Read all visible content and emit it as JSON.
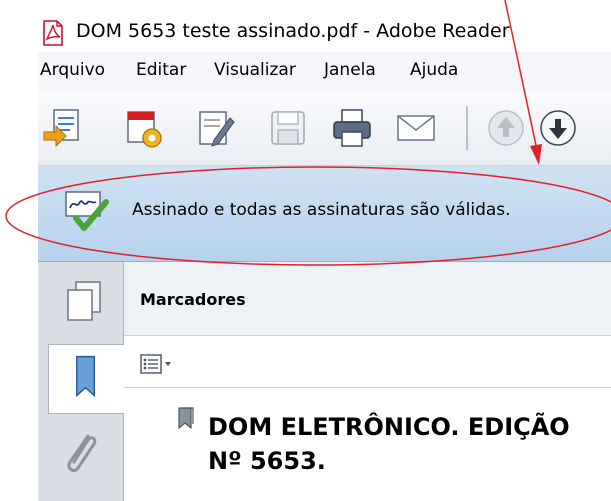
{
  "window": {
    "title": "DOM 5653 teste assinado.pdf - Adobe Reader"
  },
  "menubar": {
    "items": [
      "Arquivo",
      "Editar",
      "Visualizar",
      "Janela",
      "Ajuda"
    ]
  },
  "toolbar": {
    "buttons": [
      "create-pdf-icon",
      "settings-pdf-icon",
      "edit-icon",
      "save-icon",
      "print-icon",
      "email-icon",
      "prev-page-icon",
      "next-page-icon"
    ]
  },
  "signature_bar": {
    "message": "Assinado e todas as assinaturas são válidas.",
    "icon": "signature-valid-icon"
  },
  "nav_panel": {
    "buttons": [
      "pages-icon",
      "bookmarks-icon",
      "attachments-icon"
    ]
  },
  "bookmarks": {
    "title": "Marcadores",
    "items": [
      {
        "label": "DOM ELETRÔNICO. EDIÇÃO Nº 5653."
      }
    ]
  },
  "colors": {
    "annotation": "#e0202a",
    "signature_bar": "#c4daf0"
  }
}
